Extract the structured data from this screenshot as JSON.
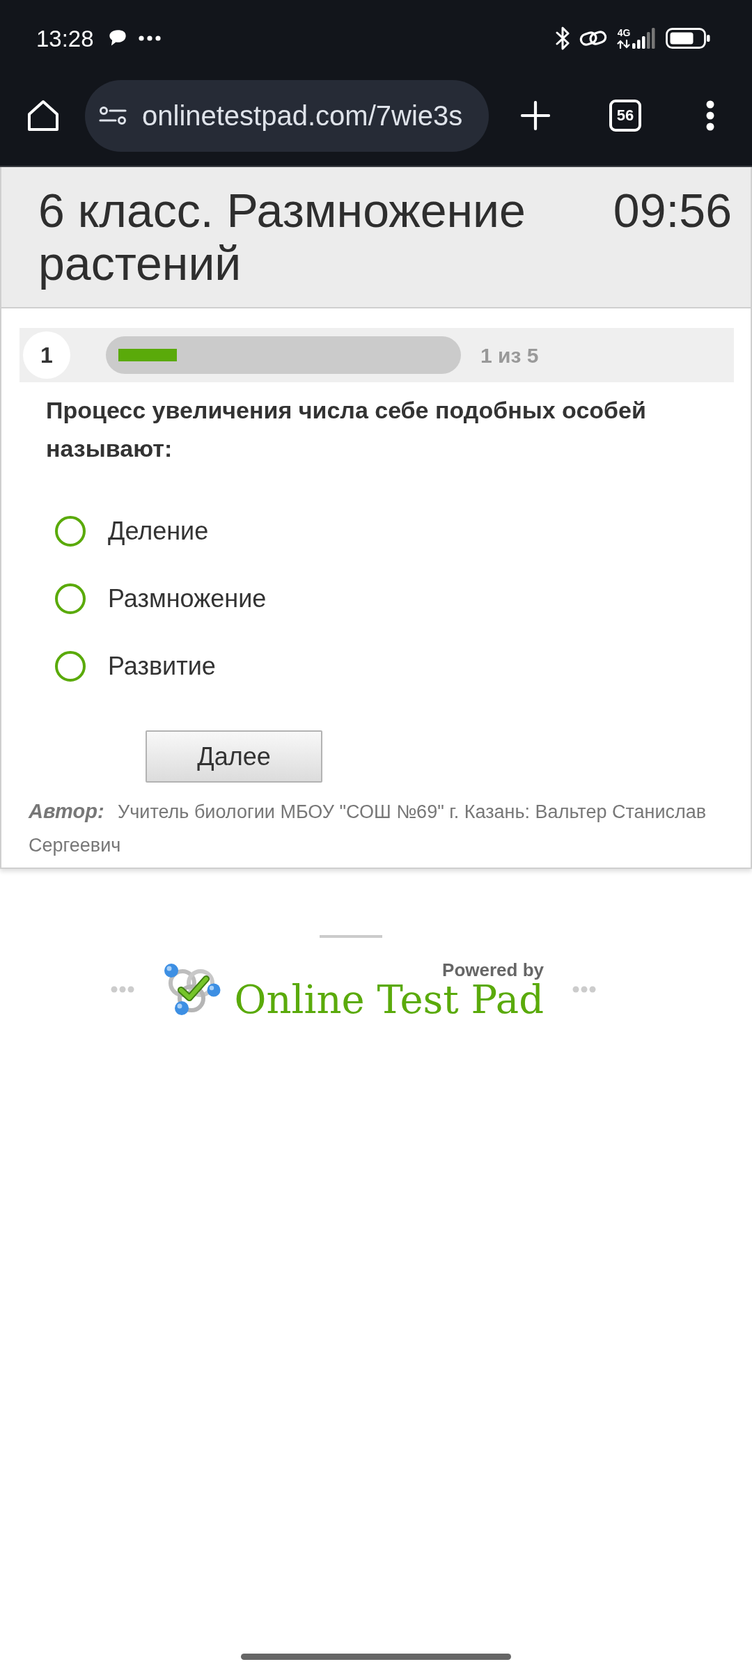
{
  "status_bar": {
    "time": "13:28",
    "network_type": "4G"
  },
  "browser": {
    "url": "onlinetestpad.com/7wie3s",
    "tab_count": "56"
  },
  "test": {
    "title": "6 класс. Размножение растений",
    "timer": "09:56"
  },
  "progress": {
    "question_number": "1",
    "level": 0.2,
    "counter": "1 из 5"
  },
  "question": {
    "text": "Процесс увеличения числа себе подобных особей называют:",
    "options": [
      {
        "label": "Деление",
        "selected": false
      },
      {
        "label": "Размножение",
        "selected": false
      },
      {
        "label": "Развитие",
        "selected": false
      }
    ]
  },
  "next_button": {
    "label": "Далее"
  },
  "author": {
    "text": "**Автор:** Учитель биологии МБОУ \"СОШ №69\" г. Казань: Вальтер Станислав Сергеевич"
  },
  "footer": {
    "powered_by": "Powered by",
    "brand": "Online Test Pad"
  }
}
